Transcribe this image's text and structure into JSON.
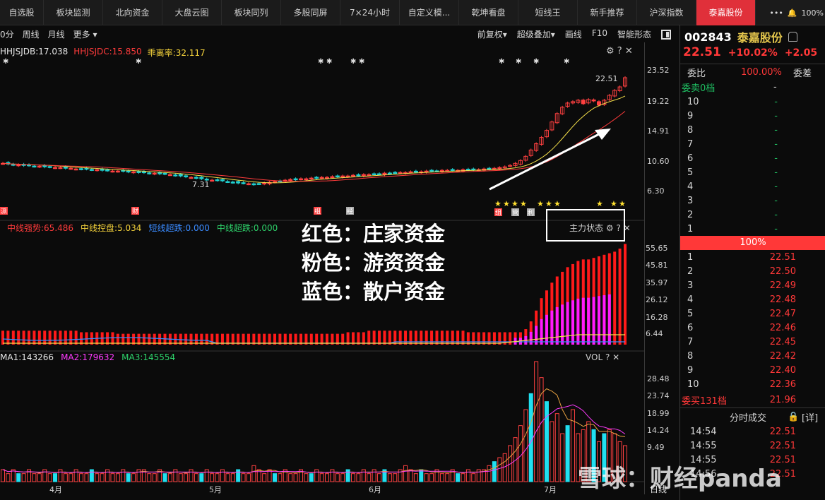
{
  "tabs": [
    "自选股",
    "板块监测",
    "北向资金",
    "大盘云图",
    "板块同列",
    "多股同屏",
    "7×24小时",
    "自定义模...",
    "乾坤看盘",
    "短线王",
    "新手推荐",
    "沪深指数",
    "泰嘉股份"
  ],
  "topright": {
    "more": "•••",
    "zoom": "100%"
  },
  "toolbar": {
    "left": [
      "0分",
      "周线",
      "月线",
      "更多 ▾"
    ],
    "right": [
      "前复权▾",
      "超级叠加▾",
      "画线",
      "F10",
      "智能形态"
    ]
  },
  "kline": {
    "legend": [
      {
        "text": "HHJSJDB:17.038",
        "color": "#e6e6e6"
      },
      {
        "text": "HHJSJDC:15.850",
        "color": "#ff3b3b"
      },
      {
        "text": "乖离率:32.117",
        "color": "#f5d33b"
      }
    ],
    "yaxis": [
      "23.52",
      "19.22",
      "14.91",
      "10.60",
      "6.30"
    ],
    "high_label": "22.51",
    "low_label": "7.31",
    "tags": [
      "派",
      "财",
      "组",
      "经",
      "组",
      "管",
      "利"
    ],
    "closes": [
      10.3,
      10.2,
      10.1,
      10.1,
      10.0,
      10.0,
      9.9,
      9.9,
      9.8,
      9.8,
      9.7,
      9.7,
      9.6,
      9.6,
      9.5,
      9.5,
      9.5,
      9.4,
      9.4,
      9.3,
      9.3,
      9.2,
      9.2,
      9.2,
      9.1,
      9.1,
      9.0,
      9.0,
      8.9,
      8.9,
      8.8,
      8.8,
      8.7,
      8.6,
      8.5,
      8.4,
      8.3,
      8.2,
      8.1,
      8.0,
      7.9,
      7.9,
      7.8,
      7.7,
      7.6,
      7.5,
      7.5,
      7.4,
      7.3,
      7.4,
      7.5,
      7.6,
      7.7,
      7.8,
      7.9,
      8.0,
      8.0,
      8.1,
      8.1,
      8.2,
      8.2,
      8.3,
      8.3,
      8.4,
      8.4,
      8.5,
      8.5,
      8.6,
      8.6,
      8.7,
      8.7,
      8.8,
      8.8,
      8.9,
      8.9,
      9.0,
      9.0,
      9.0,
      9.1,
      9.1,
      9.1,
      9.2,
      9.2,
      9.2,
      9.3,
      9.3,
      9.3,
      9.3,
      9.4,
      9.4,
      9.4,
      9.4,
      9.5,
      9.5,
      9.6,
      9.7,
      9.8,
      10.0,
      10.3,
      10.7,
      11.3,
      12.2,
      13.1,
      14.0,
      15.0,
      16.2,
      17.4,
      18.3,
      18.9,
      19.1,
      19.3,
      18.8,
      19.4,
      19.2,
      18.6,
      19.3,
      20.0,
      20.7,
      21.2,
      22.51
    ]
  },
  "fund": {
    "legend": [
      {
        "text": "中线强势:65.486",
        "color": "#ff3b3b"
      },
      {
        "text": "中线控盘:5.034",
        "color": "#f5d33b"
      },
      {
        "text": "短线超跌:0.000",
        "color": "#3a8bff"
      },
      {
        "text": "中线超跌:0.000",
        "color": "#2ed36b"
      }
    ],
    "yaxis": [
      "55.65",
      "45.81",
      "35.97",
      "26.12",
      "16.28",
      "6.44"
    ],
    "state_label": "主力状态",
    "red": [
      9,
      9,
      9,
      9,
      9,
      9,
      9,
      9,
      9,
      9,
      9,
      9,
      9,
      9,
      9,
      8,
      8,
      8,
      8,
      8,
      8,
      8,
      7,
      7,
      7,
      7,
      7,
      7,
      7,
      7,
      7,
      7,
      7,
      7,
      7,
      7,
      7,
      7,
      7,
      7,
      7,
      7,
      7,
      7,
      7,
      7,
      7,
      7,
      7,
      7,
      7,
      7,
      7,
      7,
      7,
      7,
      7,
      7,
      7,
      7,
      7,
      7,
      7,
      7,
      7,
      7,
      8,
      8,
      8,
      8,
      9,
      9,
      9,
      9,
      9,
      9,
      9,
      9,
      9,
      9,
      9,
      9,
      9,
      9,
      9,
      9,
      9,
      9,
      9,
      8,
      8,
      8,
      8,
      8,
      8,
      8,
      8,
      8,
      8,
      8,
      10,
      15,
      22,
      30,
      35,
      40,
      44,
      47,
      50,
      52,
      54,
      55,
      55,
      56,
      57,
      58,
      59,
      60,
      62,
      65
    ]
  },
  "overlay_lines": [
    "红色：庄家资金",
    "粉色：游资资金",
    "蓝色：散户资金"
  ],
  "vol": {
    "legend": [
      {
        "text": "MA1:143266",
        "color": "#e6e6e6"
      },
      {
        "text": "MA2:179632",
        "color": "#ff3bff"
      },
      {
        "text": "MA3:145554",
        "color": "#2ed36b"
      }
    ],
    "title": "VOL",
    "yaxis": [
      "28.48",
      "23.74",
      "18.99",
      "14.24",
      "9.49"
    ],
    "bars": [
      3,
      2,
      3,
      2,
      2,
      3,
      2,
      2,
      3,
      2,
      2,
      3,
      2,
      2,
      3,
      2,
      2,
      3,
      2,
      2,
      3,
      2,
      2,
      3,
      2,
      2,
      3,
      3,
      2,
      2,
      3,
      2,
      2,
      3,
      2,
      2,
      3,
      2,
      2,
      3,
      2,
      2,
      3,
      2,
      2,
      3,
      2,
      2,
      4,
      3,
      2,
      3,
      2,
      2,
      3,
      2,
      2,
      3,
      2,
      2,
      3,
      2,
      2,
      3,
      2,
      2,
      3,
      2,
      2,
      3,
      2,
      3,
      2,
      3,
      2,
      2,
      3,
      4,
      3,
      2,
      3,
      2,
      2,
      3,
      2,
      2,
      3,
      2,
      2,
      3,
      2,
      3,
      3,
      4,
      5,
      6,
      7,
      9,
      11,
      14,
      18,
      22,
      30,
      26,
      20,
      15,
      17,
      12,
      14,
      18,
      12,
      13,
      15,
      13,
      10,
      12,
      13,
      12,
      10,
      9
    ]
  },
  "xaxis": [
    "4月",
    "5月",
    "6月",
    "7月"
  ],
  "period_label": "日线",
  "quote": {
    "code": "002843",
    "name": "泰嘉股份",
    "price": "22.51",
    "pct": "+10.02%",
    "chg": "+2.05",
    "weibi_label": "委比",
    "weibi_value": "100.00%",
    "weicha_label": "委差",
    "sell_title": "委卖0档",
    "sell_dash": "-",
    "sell_levels": [
      {
        "lv": "10",
        "q": "-"
      },
      {
        "lv": "9",
        "q": "-"
      },
      {
        "lv": "8",
        "q": "-"
      },
      {
        "lv": "7",
        "q": "-"
      },
      {
        "lv": "6",
        "q": "-"
      },
      {
        "lv": "5",
        "q": "-"
      },
      {
        "lv": "4",
        "q": "-"
      },
      {
        "lv": "3",
        "q": "-"
      },
      {
        "lv": "2",
        "q": "-"
      },
      {
        "lv": "1",
        "q": "-"
      }
    ],
    "mid_value": "100%",
    "buy_levels": [
      {
        "lv": "1",
        "p": "22.51"
      },
      {
        "lv": "2",
        "p": "22.50"
      },
      {
        "lv": "3",
        "p": "22.49"
      },
      {
        "lv": "4",
        "p": "22.48"
      },
      {
        "lv": "5",
        "p": "22.47"
      },
      {
        "lv": "6",
        "p": "22.46"
      },
      {
        "lv": "7",
        "p": "22.45"
      },
      {
        "lv": "8",
        "p": "22.42"
      },
      {
        "lv": "9",
        "p": "22.40"
      },
      {
        "lv": "10",
        "p": "22.36"
      }
    ],
    "buy_title": "委买131档",
    "buy_price": "21.96",
    "ticks_title": "分时成交",
    "ticks_detail": "[详]",
    "ticks": [
      {
        "t": "14:54",
        "p": "22.51"
      },
      {
        "t": "14:55",
        "p": "22.51"
      },
      {
        "t": "14:55",
        "p": "22.51"
      },
      {
        "t": "14:56",
        "p": "22.51"
      }
    ]
  },
  "watermark": "雪球：财经panda"
}
